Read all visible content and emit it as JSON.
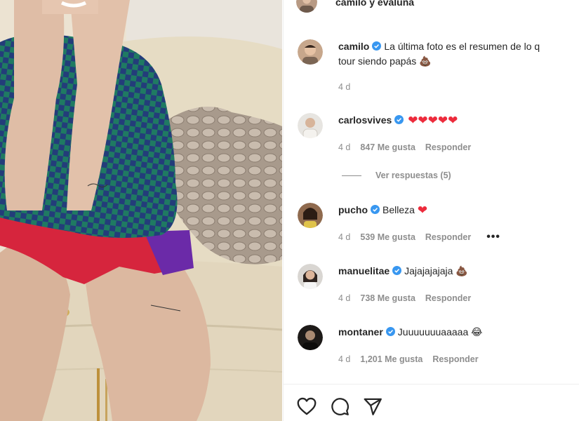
{
  "post": {
    "header_title": "camilo y evaluna"
  },
  "comments": [
    {
      "user": "camilo",
      "verified": true,
      "text": "La última foto es el resumen de lo q",
      "text_line2": "tour siendo papás",
      "emoji": "💩",
      "age": "4 d",
      "likes": "",
      "reply_label": ""
    },
    {
      "user": "carlosvives",
      "verified": true,
      "text": "",
      "emoji": "❤❤❤❤❤",
      "age": "4 d",
      "likes": "847 Me gusta",
      "reply_label": "Responder",
      "view_replies": "Ver respuestas (5)"
    },
    {
      "user": "pucho",
      "verified": true,
      "text": "Belleza",
      "emoji": "❤",
      "age": "4 d",
      "likes": "539 Me gusta",
      "reply_label": "Responder",
      "more": "•••"
    },
    {
      "user": "manuelitae",
      "verified": true,
      "text": "Jajajajajaja",
      "emoji": "💩",
      "age": "4 d",
      "likes": "738 Me gusta",
      "reply_label": "Responder"
    },
    {
      "user": "montaner",
      "verified": true,
      "text": "Juuuuuuuaaaaa",
      "emoji": "😂",
      "age": "4 d",
      "likes": "1,201 Me gusta",
      "reply_label": "Responder"
    }
  ],
  "actions": {
    "like_icon": "heart-outline-icon",
    "comment_icon": "comment-bubble-icon",
    "share_icon": "paper-plane-icon"
  },
  "colors": {
    "verified_blue": "#3897f0",
    "meta_gray": "#8e8e8e",
    "heart_red": "#ed2b3c"
  }
}
